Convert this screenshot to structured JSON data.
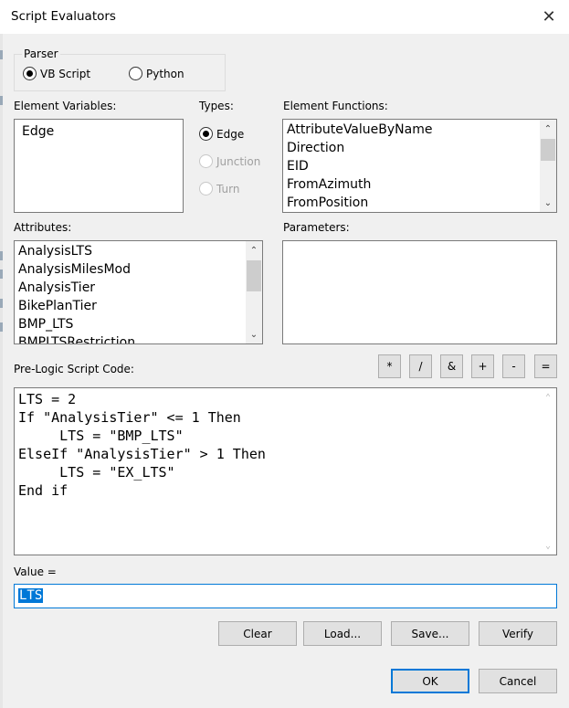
{
  "window": {
    "title": "Script Evaluators"
  },
  "parser": {
    "label": "Parser",
    "options": [
      {
        "label": "VB Script",
        "selected": true
      },
      {
        "label": "Python",
        "selected": false
      }
    ]
  },
  "element_variables": {
    "label": "Element Variables:",
    "items": [
      "Edge"
    ]
  },
  "types": {
    "label": "Types:",
    "options": [
      {
        "label": "Edge",
        "selected": true,
        "enabled": true
      },
      {
        "label": "Junction",
        "selected": false,
        "enabled": false
      },
      {
        "label": "Turn",
        "selected": false,
        "enabled": false
      }
    ]
  },
  "element_functions": {
    "label": "Element Functions:",
    "items": [
      "AttributeValueByName",
      "Direction",
      "EID",
      "FromAzimuth",
      "FromPosition"
    ]
  },
  "attributes": {
    "label": "Attributes:",
    "items": [
      "AnalysisLTS",
      "AnalysisMilesMod",
      "AnalysisTier",
      "BikePlanTier",
      "BMP_LTS",
      "BMPLTSRestriction"
    ]
  },
  "parameters": {
    "label": "Parameters:"
  },
  "prelogic": {
    "label": "Pre-Logic Script Code:",
    "operators": [
      "*",
      "/",
      "&",
      "+",
      "-",
      "="
    ],
    "code_lines": [
      "LTS = 2",
      "If \"AnalysisTier\" <= 1 Then",
      "     LTS = \"BMP_LTS\"",
      "ElseIf \"AnalysisTier\" > 1 Then",
      "     LTS = \"EX_LTS\"",
      "End if"
    ]
  },
  "value": {
    "label": "Value =",
    "text": "LTS"
  },
  "buttons": {
    "clear": "Clear",
    "load": "Load...",
    "save": "Save...",
    "verify": "Verify",
    "ok": "OK",
    "cancel": "Cancel"
  },
  "icons": {
    "close": "close-icon",
    "scroll_up": "chevron-up-icon",
    "scroll_down": "chevron-down-icon"
  },
  "colors": {
    "accent": "#0078d7",
    "background": "#f0f0f0",
    "disabled_text": "#a0a0a0"
  }
}
